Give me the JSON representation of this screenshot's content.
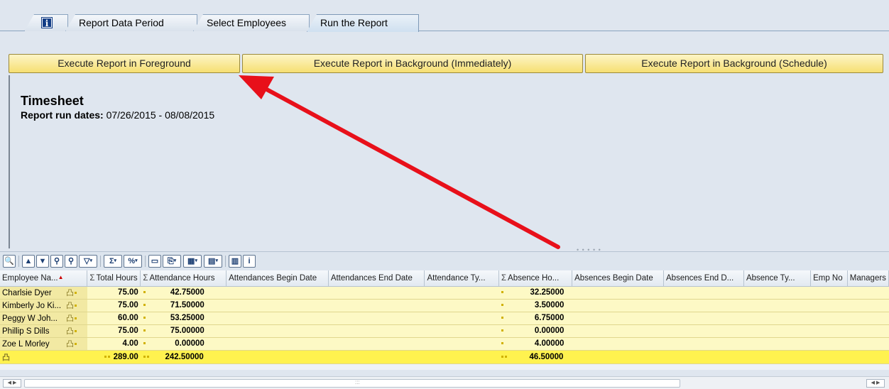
{
  "tabs": [
    {
      "label": "",
      "icon": "info-icon"
    },
    {
      "label": "Report Data Period"
    },
    {
      "label": "Select Employees"
    },
    {
      "label": "Run the Report"
    }
  ],
  "buttons": {
    "foreground": "Execute Report in Foreground",
    "background_now": "Execute Report in Background (Immediately)",
    "background_schedule": "Execute Report in Background (Schedule)"
  },
  "report": {
    "title": "Timesheet",
    "dates_label": "Report run dates:",
    "dates_value": "07/26/2015 - 08/08/2015"
  },
  "grid": {
    "columns": [
      {
        "label": "Employee Na...",
        "sigma": false,
        "sorted": true
      },
      {
        "label": "Total Hours",
        "sigma": true
      },
      {
        "label": "Attendance Hours",
        "sigma": true
      },
      {
        "label": "Attendances Begin Date",
        "sigma": false
      },
      {
        "label": "Attendances End Date",
        "sigma": false
      },
      {
        "label": "Attendance Ty...",
        "sigma": false
      },
      {
        "label": "Absence Ho...",
        "sigma": true
      },
      {
        "label": "Absences Begin Date",
        "sigma": false
      },
      {
        "label": "Absences End D...",
        "sigma": false
      },
      {
        "label": "Absence Ty...",
        "sigma": false
      },
      {
        "label": "Emp No",
        "sigma": false
      },
      {
        "label": "Managers",
        "sigma": false
      }
    ],
    "rows": [
      {
        "name": "Charlsie Dyer",
        "total": "75.00",
        "attendance": "42.75000",
        "absence": "32.25000"
      },
      {
        "name": "Kimberly Jo Ki...",
        "total": "75.00",
        "attendance": "71.50000",
        "absence": "3.50000"
      },
      {
        "name": "Peggy W Joh...",
        "total": "60.00",
        "attendance": "53.25000",
        "absence": "6.75000"
      },
      {
        "name": "Phillip S Dills",
        "total": "75.00",
        "attendance": "75.00000",
        "absence": "0.00000"
      },
      {
        "name": "Zoe L Morley",
        "total": "4.00",
        "attendance": "0.00000",
        "absence": "4.00000"
      }
    ],
    "totals": {
      "total": "289.00",
      "attendance": "242.50000",
      "absence": "46.50000"
    }
  },
  "colors": {
    "button_yellow": "#f6df72",
    "row_yellow": "#fdf9c5",
    "total_yellow": "#fff24f",
    "arrow_red": "#e8101a"
  }
}
